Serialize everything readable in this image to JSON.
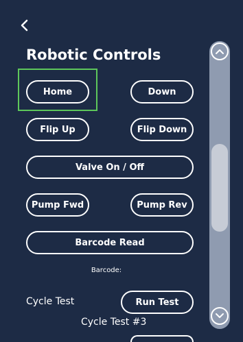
{
  "header": {
    "back_icon": "chevron-left-icon",
    "title": "Robotic Controls"
  },
  "controls": {
    "home": "Home",
    "down": "Down",
    "flip_up": "Flip Up",
    "flip_down": "Flip Down",
    "valve": "Valve On / Off",
    "pump_fwd": "Pump Fwd",
    "pump_rev": "Pump Rev",
    "barcode_read": "Barcode Read"
  },
  "barcode": {
    "label": "Barcode:"
  },
  "cycle": {
    "label": "Cycle Test",
    "run_button": "Run Test",
    "current_name": "Cycle Test #3"
  },
  "scrollbar": {
    "up_icon": "chevron-up-icon",
    "down_icon": "chevron-down-icon"
  },
  "colors": {
    "background": "#1d2b45",
    "highlight": "#5ec85b",
    "scroll_track": "#8f9bb0",
    "scroll_thumb": "#c7ccd6"
  }
}
